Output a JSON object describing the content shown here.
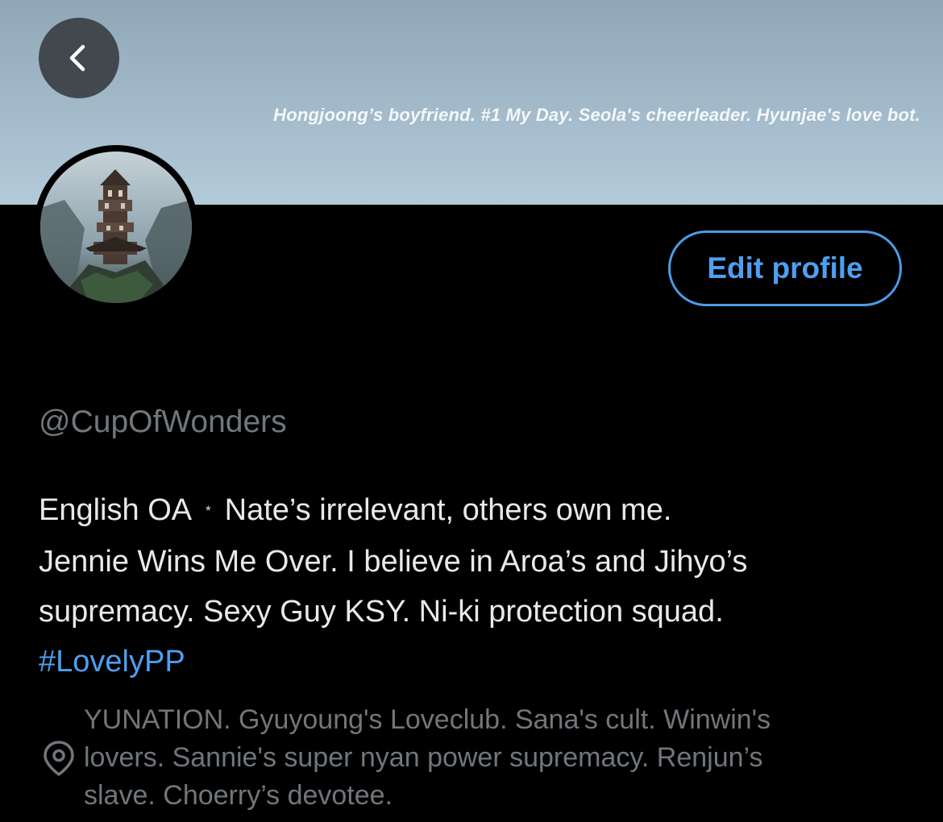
{
  "banner": {
    "tagline": "Hongjoong’s boyfriend. #1 My Day. Seola's cheerleader. Hyunjae's love bot."
  },
  "header": {
    "back_icon": "chevron-left-icon"
  },
  "profile": {
    "avatar_icon": "avatar-house-image",
    "edit_button_label": "Edit profile",
    "handle": "@CupOfWonders",
    "bio": {
      "line1_before": "English OA",
      "line1_separator": "⋆",
      "line1_after": "Nate’s irrelevant, others own me.",
      "line2": "Jennie Wins Me Over. I believe in Aroa’s and Jihyo’s",
      "line3": "supremacy. Sexy Guy KSY. Ni-ki protection squad.",
      "hashtag": "#LovelyPP"
    },
    "location": {
      "icon": "location-pin-icon",
      "line1": "YUNATION. Gyuyoung's Loveclub. Sana's cult. Winwin's",
      "line2": "lovers. Sannie's super nyan power supremacy. Renjun’s",
      "line3": "slave. Choerry’s devotee."
    }
  },
  "colors": {
    "background": "#000000",
    "accent": "#4e9ff0",
    "secondary_text": "#71767b",
    "primary_text": "#e7e9ea"
  }
}
